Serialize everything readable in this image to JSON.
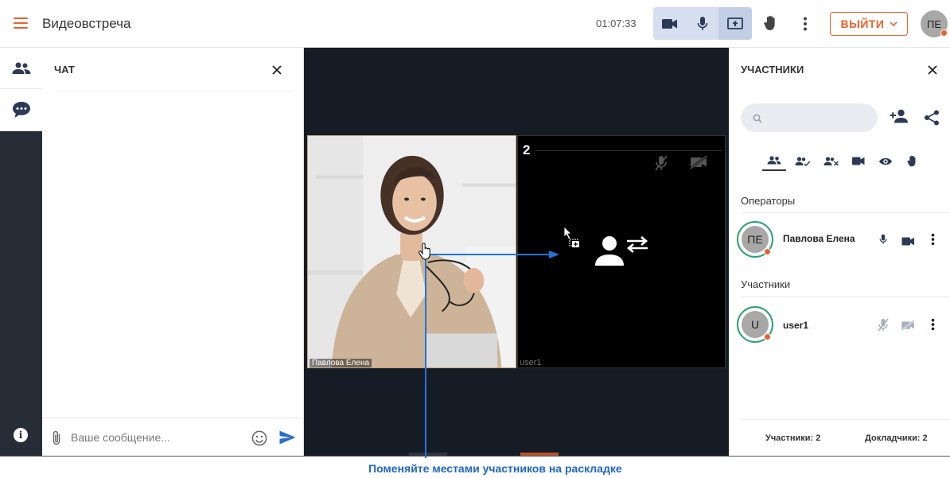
{
  "header": {
    "title": "Видеовстреча",
    "timer": "01:07:33",
    "exit_label": "ВЫЙТИ",
    "user_initials": "ПЕ",
    "accent": "#e8612c"
  },
  "chat": {
    "title": "ЧАТ",
    "input_placeholder": "Ваше сообщение..."
  },
  "stage": {
    "tiles": [
      {
        "number": "",
        "label": "Павлова Елена"
      },
      {
        "number": "2",
        "label": "user1"
      }
    ]
  },
  "participants_panel": {
    "title": "УЧАСТНИКИ",
    "search_placeholder": "",
    "filter_tabs": [
      "all-icon",
      "present-icon",
      "absent-icon",
      "camera-icon",
      "eye-icon",
      "hand-icon"
    ],
    "sections": [
      {
        "title": "Операторы",
        "people": [
          {
            "initials": "ПЕ",
            "name": "Павлова Елена",
            "mic": "on",
            "cam": "on"
          }
        ]
      },
      {
        "title": "Участники",
        "people": [
          {
            "initials": "U",
            "name": "user1",
            "mic": "off",
            "cam": "off"
          }
        ]
      }
    ],
    "footer": {
      "participants": "Участники: 2",
      "speakers": "Докладчики: 2"
    }
  },
  "tutorial": {
    "caption": "Поменяйте местами участников на раскладке"
  }
}
